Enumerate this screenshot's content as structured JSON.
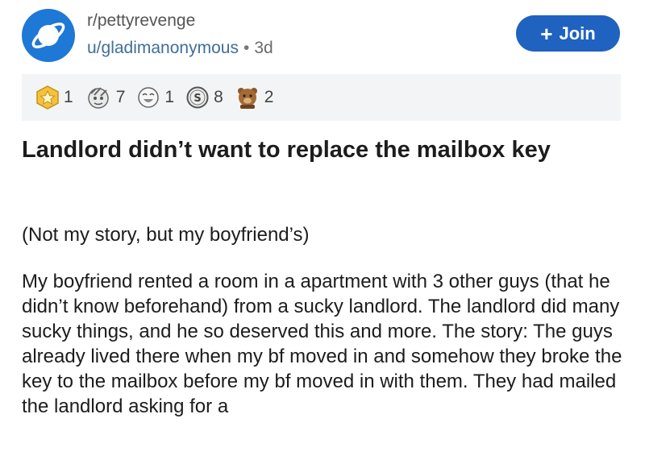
{
  "post_header": {
    "subreddit": "r/pettyrevenge",
    "username": "u/gladimanonymous",
    "separator": "•",
    "age": "3d",
    "join_label": "Join"
  },
  "awards": [
    {
      "icon": "star-award-icon",
      "count": "1"
    },
    {
      "icon": "eyeroll-face-award-icon",
      "count": "7"
    },
    {
      "icon": "rofl-face-award-icon",
      "count": "1"
    },
    {
      "icon": "silver-coin-award-icon",
      "count": "8"
    },
    {
      "icon": "bear-award-icon",
      "count": "2"
    }
  ],
  "post": {
    "title": "Landlord didn’t want to replace the mailbox key",
    "intro": "(Not my story, but my boyfriend’s)",
    "body": "My boyfriend rented a room in a apartment with 3 other guys (that he didn’t know beforehand) from a sucky landlord. The landlord did many sucky things, and he so deserved this and more. The story: The guys already lived there when my bf moved in and somehow they broke the key to the mailbox before my bf moved in with them. They had mailed the landlord asking for a"
  },
  "colors": {
    "accent": "#1f62c0",
    "avatar_bg": "#1e78d6",
    "award_bar_bg": "#f3f4f5",
    "username": "#3f6f98"
  }
}
